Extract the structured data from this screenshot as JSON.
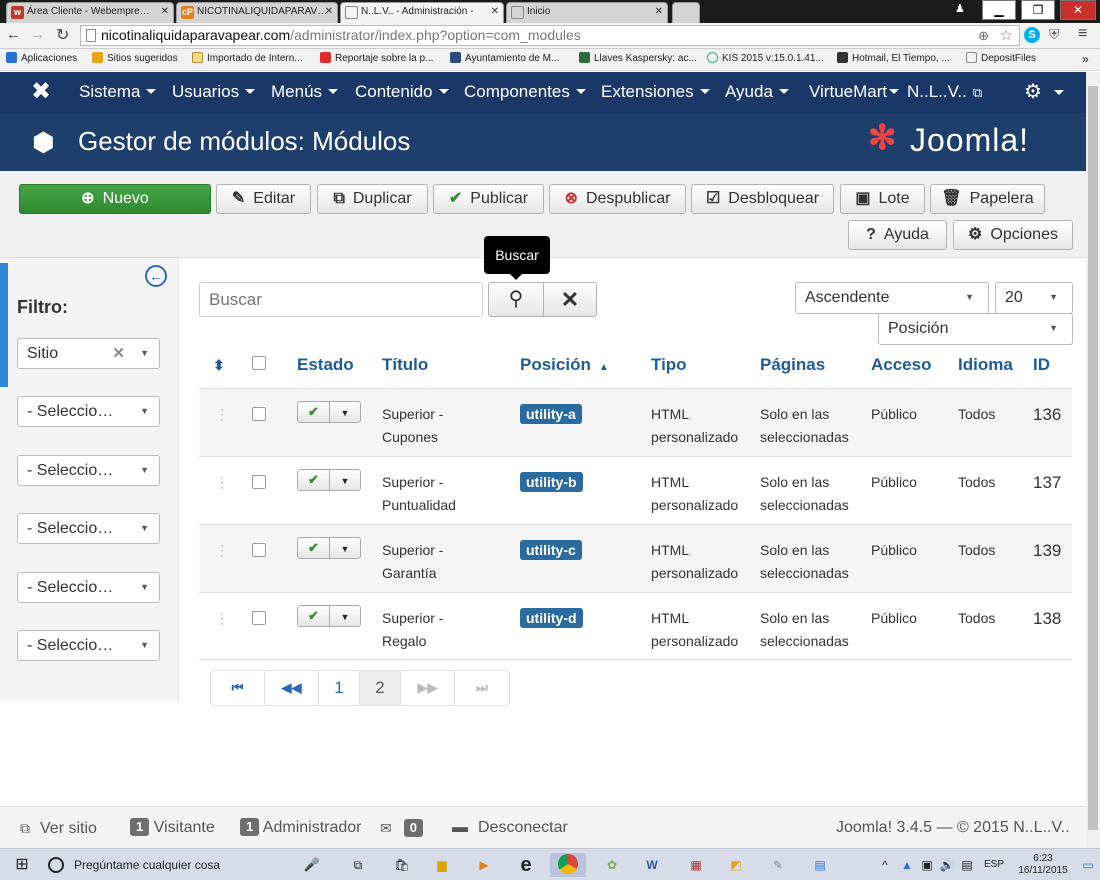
{
  "browser": {
    "tabs": [
      {
        "label": "Área Cliente - Webempre…"
      },
      {
        "label": "NICOTINALIQUIDAPARAV…"
      },
      {
        "label": "N..L.V.. - Administración -"
      },
      {
        "label": "Inicio"
      }
    ],
    "url_host": "nicotinaliquidaparavapear.com",
    "url_path": "/administrator/index.php?option=com_modules",
    "bookmarks": [
      "Aplicaciones",
      "Sitios sugeridos",
      "Importado de Intern...",
      "Reportaje sobre la p...",
      "Ayuntamiento de M...",
      "Llaves Kaspersky: ac...",
      "KIS 2015 v:15.0.1.41...",
      "Hotmail, El Tiempo, ...",
      "DepositFiles"
    ]
  },
  "nav": {
    "items": [
      "Sistema",
      "Usuarios",
      "Menús",
      "Contenido",
      "Componentes",
      "Extensiones",
      "Ayuda",
      "VirtueMart"
    ],
    "site": "N..L..V.."
  },
  "header": {
    "title": "Gestor de módulos: Módulos",
    "brand": "Joomla!"
  },
  "toolbar": {
    "new": "Nuevo",
    "edit": "Editar",
    "duplicate": "Duplicar",
    "publish": "Publicar",
    "unpublish": "Despublicar",
    "checkin": "Desbloquear",
    "batch": "Lote",
    "trash": "Papelera",
    "help": "Ayuda",
    "options": "Opciones"
  },
  "sidebar": {
    "filter_label": "Filtro:",
    "site_filter": "Sitio",
    "selects": [
      "- Seleccio…",
      "- Seleccio…",
      "- Seleccio…",
      "- Seleccio…",
      "- Seleccio…"
    ]
  },
  "search": {
    "placeholder": "Buscar",
    "tooltip": "Buscar"
  },
  "list_controls": {
    "order_dir": "Ascendente",
    "limit": "20",
    "order_by": "Posición"
  },
  "table": {
    "headers": {
      "status": "Estado",
      "title": "Título",
      "position": "Posición",
      "type": "Tipo",
      "pages": "Páginas",
      "access": "Acceso",
      "language": "Idioma",
      "id": "ID"
    },
    "rows": [
      {
        "title1": "Superior -",
        "title2": "Cupones",
        "position": "utility-a",
        "type1": "HTML",
        "type2": "personalizado",
        "pages1": "Solo en las",
        "pages2": "seleccionadas",
        "access": "Público",
        "language": "Todos",
        "id": "136"
      },
      {
        "title1": "Superior -",
        "title2": "Puntualidad",
        "position": "utility-b",
        "type1": "HTML",
        "type2": "personalizado",
        "pages1": "Solo en las",
        "pages2": "seleccionadas",
        "access": "Público",
        "language": "Todos",
        "id": "137"
      },
      {
        "title1": "Superior -",
        "title2": "Garantía",
        "position": "utility-c",
        "type1": "HTML",
        "type2": "personalizado",
        "pages1": "Solo en las",
        "pages2": "seleccionadas",
        "access": "Público",
        "language": "Todos",
        "id": "139"
      },
      {
        "title1": "Superior -",
        "title2": "Regalo",
        "position": "utility-d",
        "type1": "HTML",
        "type2": "personalizado",
        "pages1": "Solo en las",
        "pages2": "seleccionadas",
        "access": "Público",
        "language": "Todos",
        "id": "138"
      }
    ]
  },
  "pagination": {
    "pages": [
      "1",
      "2"
    ]
  },
  "footer": {
    "view_site": "Ver sitio",
    "visitors_count": "1",
    "visitors": "Visitante",
    "admins_count": "1",
    "admins": "Administrador",
    "messages_count": "0",
    "logout": "Desconectar",
    "version": "Joomla! 3.4.5 — © 2015 N..L..V.."
  },
  "taskbar": {
    "search": "Pregúntame cualquier cosa",
    "lang": "ESP",
    "time": "6:23",
    "date": "16/11/2015"
  },
  "colors": {
    "nav": "#1a3867",
    "header": "#1e3e6c",
    "green": "#46a546",
    "link": "#2a69b8",
    "badge": "#2c6b9e"
  }
}
